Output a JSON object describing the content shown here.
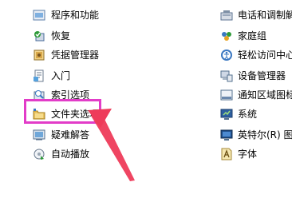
{
  "left_items": [
    {
      "label": "程序和功能",
      "icon": "programs-icon"
    },
    {
      "label": "恢复",
      "icon": "recovery-icon"
    },
    {
      "label": "凭据管理器",
      "icon": "credential-manager-icon"
    },
    {
      "label": "入门",
      "icon": "getting-started-icon"
    },
    {
      "label": "索引选项",
      "icon": "indexing-options-icon"
    },
    {
      "label": "文件夹选项",
      "icon": "folder-options-icon"
    },
    {
      "label": "疑难解答",
      "icon": "troubleshooting-icon"
    },
    {
      "label": "自动播放",
      "icon": "autoplay-icon"
    }
  ],
  "right_items": [
    {
      "label": "电话和调制解",
      "icon": "phone-modem-icon"
    },
    {
      "label": "家庭组",
      "icon": "homegroup-icon"
    },
    {
      "label": "轻松访问中心",
      "icon": "ease-of-access-icon"
    },
    {
      "label": "设备管理器",
      "icon": "device-manager-icon"
    },
    {
      "label": "通知区域图标",
      "icon": "notification-area-icon"
    },
    {
      "label": "系统",
      "icon": "system-icon"
    },
    {
      "label": "英特尔(R) 图",
      "icon": "intel-graphics-icon"
    },
    {
      "label": "字体",
      "icon": "fonts-icon"
    }
  ],
  "colors": {
    "highlight": "#e23cc8",
    "arrow": "#ee3b5a"
  }
}
